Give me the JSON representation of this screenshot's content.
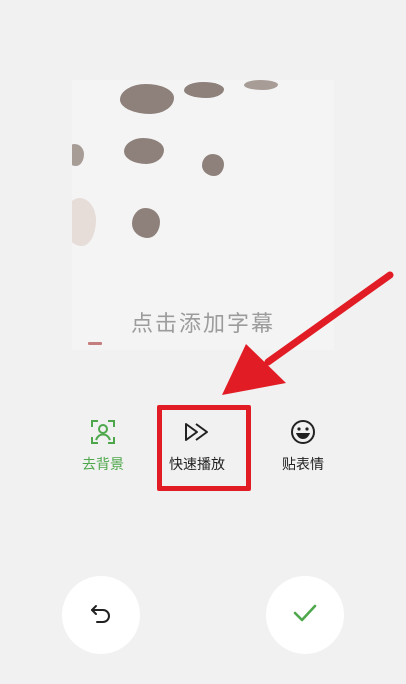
{
  "preview": {
    "subtitle_placeholder": "点击添加字幕"
  },
  "tools": [
    {
      "id": "remove-bg",
      "label": "去背景",
      "icon": "person-frame-icon",
      "active": true
    },
    {
      "id": "fast-play",
      "label": "快速播放",
      "icon": "fast-forward-icon",
      "active": false
    },
    {
      "id": "sticker",
      "label": "贴表情",
      "icon": "smiley-icon",
      "active": false
    }
  ],
  "actions": {
    "undo_icon": "undo-arrow-icon",
    "confirm_icon": "check-icon"
  },
  "colors": {
    "accent_green": "#4ea84b",
    "highlight_red": "#e11c24",
    "background": "#f1f1f1"
  }
}
